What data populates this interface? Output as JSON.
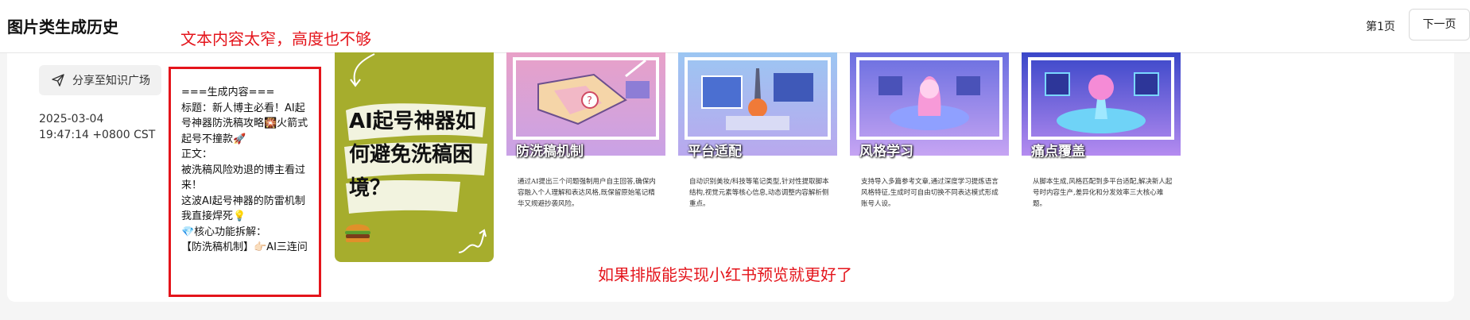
{
  "header": {
    "title": "图片类生成历史",
    "page_indicator": "第1页",
    "next_label": "下一页"
  },
  "entry": {
    "share_label": "分享至知识广场",
    "timestamp": "2025-03-04\n19:47:14 +0800 CST",
    "text_content": [
      "===生成内容===",
      "标题：新人博主必看！AI起号神器防洗稿攻略🎇火箭式起号不撞款🚀",
      "",
      "正文：",
      "被洗稿风险劝退的博主看过来！",
      "这波AI起号神器的防雷机制我直接焊死💡",
      "",
      "💎核心功能拆解：",
      "【防洗稿机制】👉🏻AI三连问"
    ],
    "cover": {
      "title": "AI起号神器如何避免洗稿困境？",
      "bg_color": "#a6ad2d"
    },
    "thumbnails": [
      {
        "label": "防洗稿机制",
        "desc": "通过AI提出三个问题强制用户自主回答,确保内容融入个人理解和表达风格,既保留原始笔记精华又规避抄袭风险。",
        "icon": "puzzle-map-icon"
      },
      {
        "label": "平台适配",
        "desc": "自动识别美妆/科技等笔记类型,针对性提取脚本结构,视觉元素等核心信息,动态调整内容解析侧重点。",
        "icon": "microscope-lab-icon"
      },
      {
        "label": "风格学习",
        "desc": "支持导入多篇参考文章,通过深度学习提炼语言风格特征,生成时可自由切换不同表达模式形成账号人设。",
        "icon": "ai-brain-icon"
      },
      {
        "label": "痛点覆盖",
        "desc": "从脚本生成,风格匹配到多平台适配,解决新人起号时内容生产,差异化和分发效率三大核心难题。",
        "icon": "tech-hub-icon"
      }
    ]
  },
  "annotations": {
    "note_text_too_narrow": "文本内容太窄，高度也不够",
    "note_layout_preview": "如果排版能实现小红书预览就更好了",
    "color": "#e4141b"
  }
}
